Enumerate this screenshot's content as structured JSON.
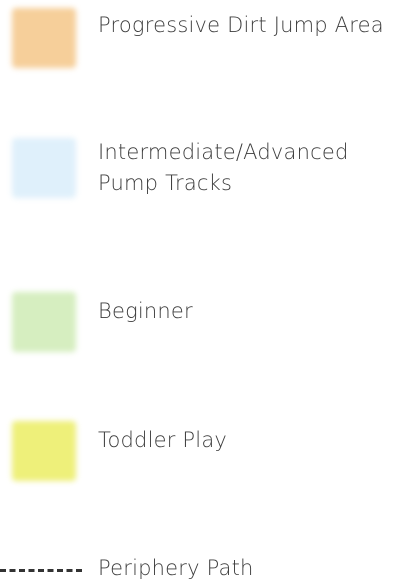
{
  "legend": {
    "items": [
      {
        "label": "Progressive Dirt Jump Area",
        "swatch_color": "#f6cf9a"
      },
      {
        "label": "Intermediate/Advanced\nPump Tracks",
        "swatch_color": "#dff0fb"
      },
      {
        "label": "Beginner",
        "swatch_color": "#d6eec0"
      },
      {
        "label": "Toddler Play",
        "swatch_color": "#eef07a"
      }
    ],
    "path": {
      "label": "Periphery Path",
      "line_style": "dashed",
      "line_color": "#333333"
    }
  }
}
